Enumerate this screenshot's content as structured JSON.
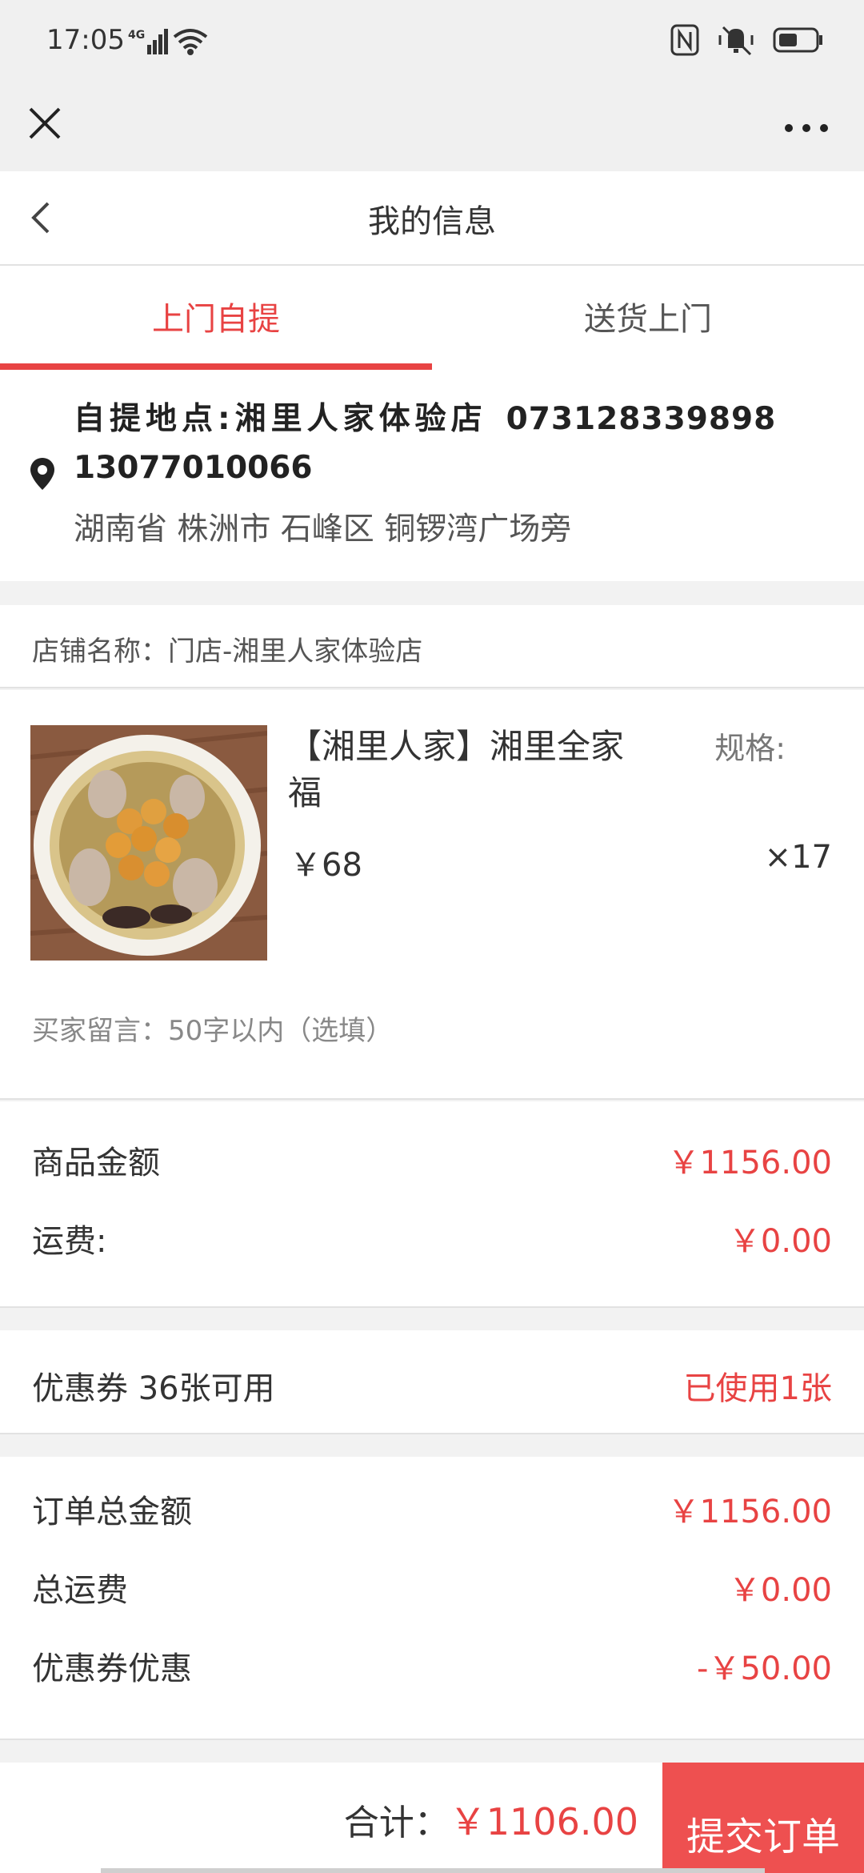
{
  "status": {
    "time": "17:05",
    "network": "4G"
  },
  "page": {
    "title": "我的信息"
  },
  "tabs": [
    {
      "label": "上门自提",
      "active": true
    },
    {
      "label": "送货上门",
      "active": false
    }
  ],
  "pickup": {
    "label": "自提地点:湘里人家体验店",
    "store_phone": "073128339898",
    "mobile": "13077010066",
    "address": "湖南省 株洲市 石峰区 铜锣湾广场旁"
  },
  "store": {
    "name_text": "店铺名称：门店-湘里人家体验店"
  },
  "product": {
    "name": "【湘里人家】湘里全家福",
    "spec_label": "规格:",
    "price": "￥68",
    "qty": "×17",
    "message_placeholder": "买家留言：50字以内（选填）"
  },
  "fees": {
    "goods_label": "商品金额",
    "goods_value": "￥1156.00",
    "shipping_label": "运费:",
    "shipping_value": "￥0.00"
  },
  "coupon": {
    "label": "优惠券 36张可用",
    "value": "已使用1张"
  },
  "totals": {
    "order_total_label": "订单总金额",
    "order_total_value": "￥1156.00",
    "total_shipping_label": "总运费",
    "total_shipping_value": "￥0.00",
    "coupon_discount_label": "优惠券优惠",
    "coupon_discount_value": "-￥50.00"
  },
  "footer": {
    "sum_label": "合计：",
    "sum_value": "￥1106.00",
    "submit_label": "提交订单"
  },
  "colors": {
    "accent": "#e84343",
    "submit_bg": "#ee5050"
  }
}
